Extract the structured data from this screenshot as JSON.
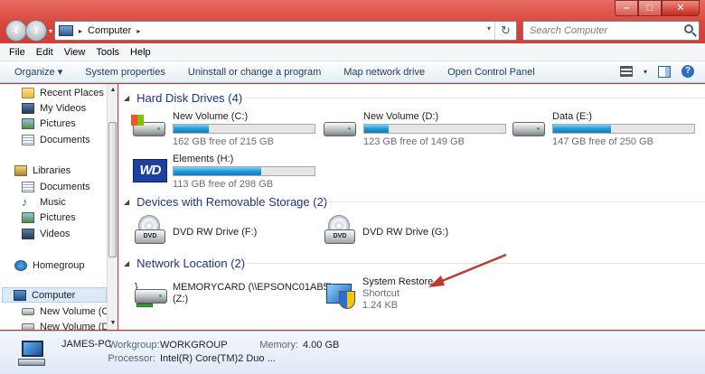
{
  "address": {
    "location": "Computer"
  },
  "search": {
    "placeholder": "Search Computer"
  },
  "menu": [
    "File",
    "Edit",
    "View",
    "Tools",
    "Help"
  ],
  "toolbar": {
    "organize": "Organize ▾",
    "system_properties": "System properties",
    "uninstall": "Uninstall or change a program",
    "map_drive": "Map network drive",
    "control_panel": "Open Control Panel"
  },
  "nav": {
    "recent_places": "Recent Places",
    "my_videos": "My Videos",
    "pictures": "Pictures",
    "documents": "Documents",
    "libraries": "Libraries",
    "lib_documents": "Documents",
    "lib_music": "Music",
    "lib_pictures": "Pictures",
    "lib_videos": "Videos",
    "homegroup": "Homegroup",
    "computer": "Computer",
    "drive_c": "New Volume (C:)",
    "drive_d": "New Volume (D:)"
  },
  "groups": {
    "hdd": "Hard Disk Drives (4)",
    "removable": "Devices with Removable Storage (2)",
    "network": "Network Location (2)"
  },
  "drives": [
    {
      "name": "New Volume (C:)",
      "free": "162 GB free of 215 GB",
      "used_fraction": 0.25
    },
    {
      "name": "New Volume (D:)",
      "free": "123 GB free of 149 GB",
      "used_fraction": 0.17
    },
    {
      "name": "Data (E:)",
      "free": "147 GB free of 250 GB",
      "used_fraction": 0.41
    },
    {
      "name": "Elements (H:)",
      "free": "113 GB free of 298 GB",
      "used_fraction": 0.62,
      "logo": "WD"
    }
  ],
  "removable": [
    {
      "name": "DVD RW Drive (F:)",
      "badge": "DVD"
    },
    {
      "name": "DVD RW Drive (G:)",
      "badge": "DVD"
    }
  ],
  "network": [
    {
      "name": "MEMORYCARD (\\\\EPSONC01AB5)",
      "sub": "(Z:)"
    },
    {
      "name": "System Restore",
      "type": "Shortcut",
      "size": "1.24 KB"
    }
  ],
  "details": {
    "pc_name": "JAMES-PC",
    "workgroup_label": "Workgroup:",
    "workgroup": "WORKGROUP",
    "memory_label": "Memory:",
    "memory": "4.00 GB",
    "processor_label": "Processor:",
    "processor": "Intel(R) Core(TM)2 Duo ..."
  },
  "colors": {
    "titlebar": "#d5453a",
    "group_header": "#1e3287",
    "annotation_arrow": "#c0392b",
    "bar_fill": "#1e9cd8"
  }
}
